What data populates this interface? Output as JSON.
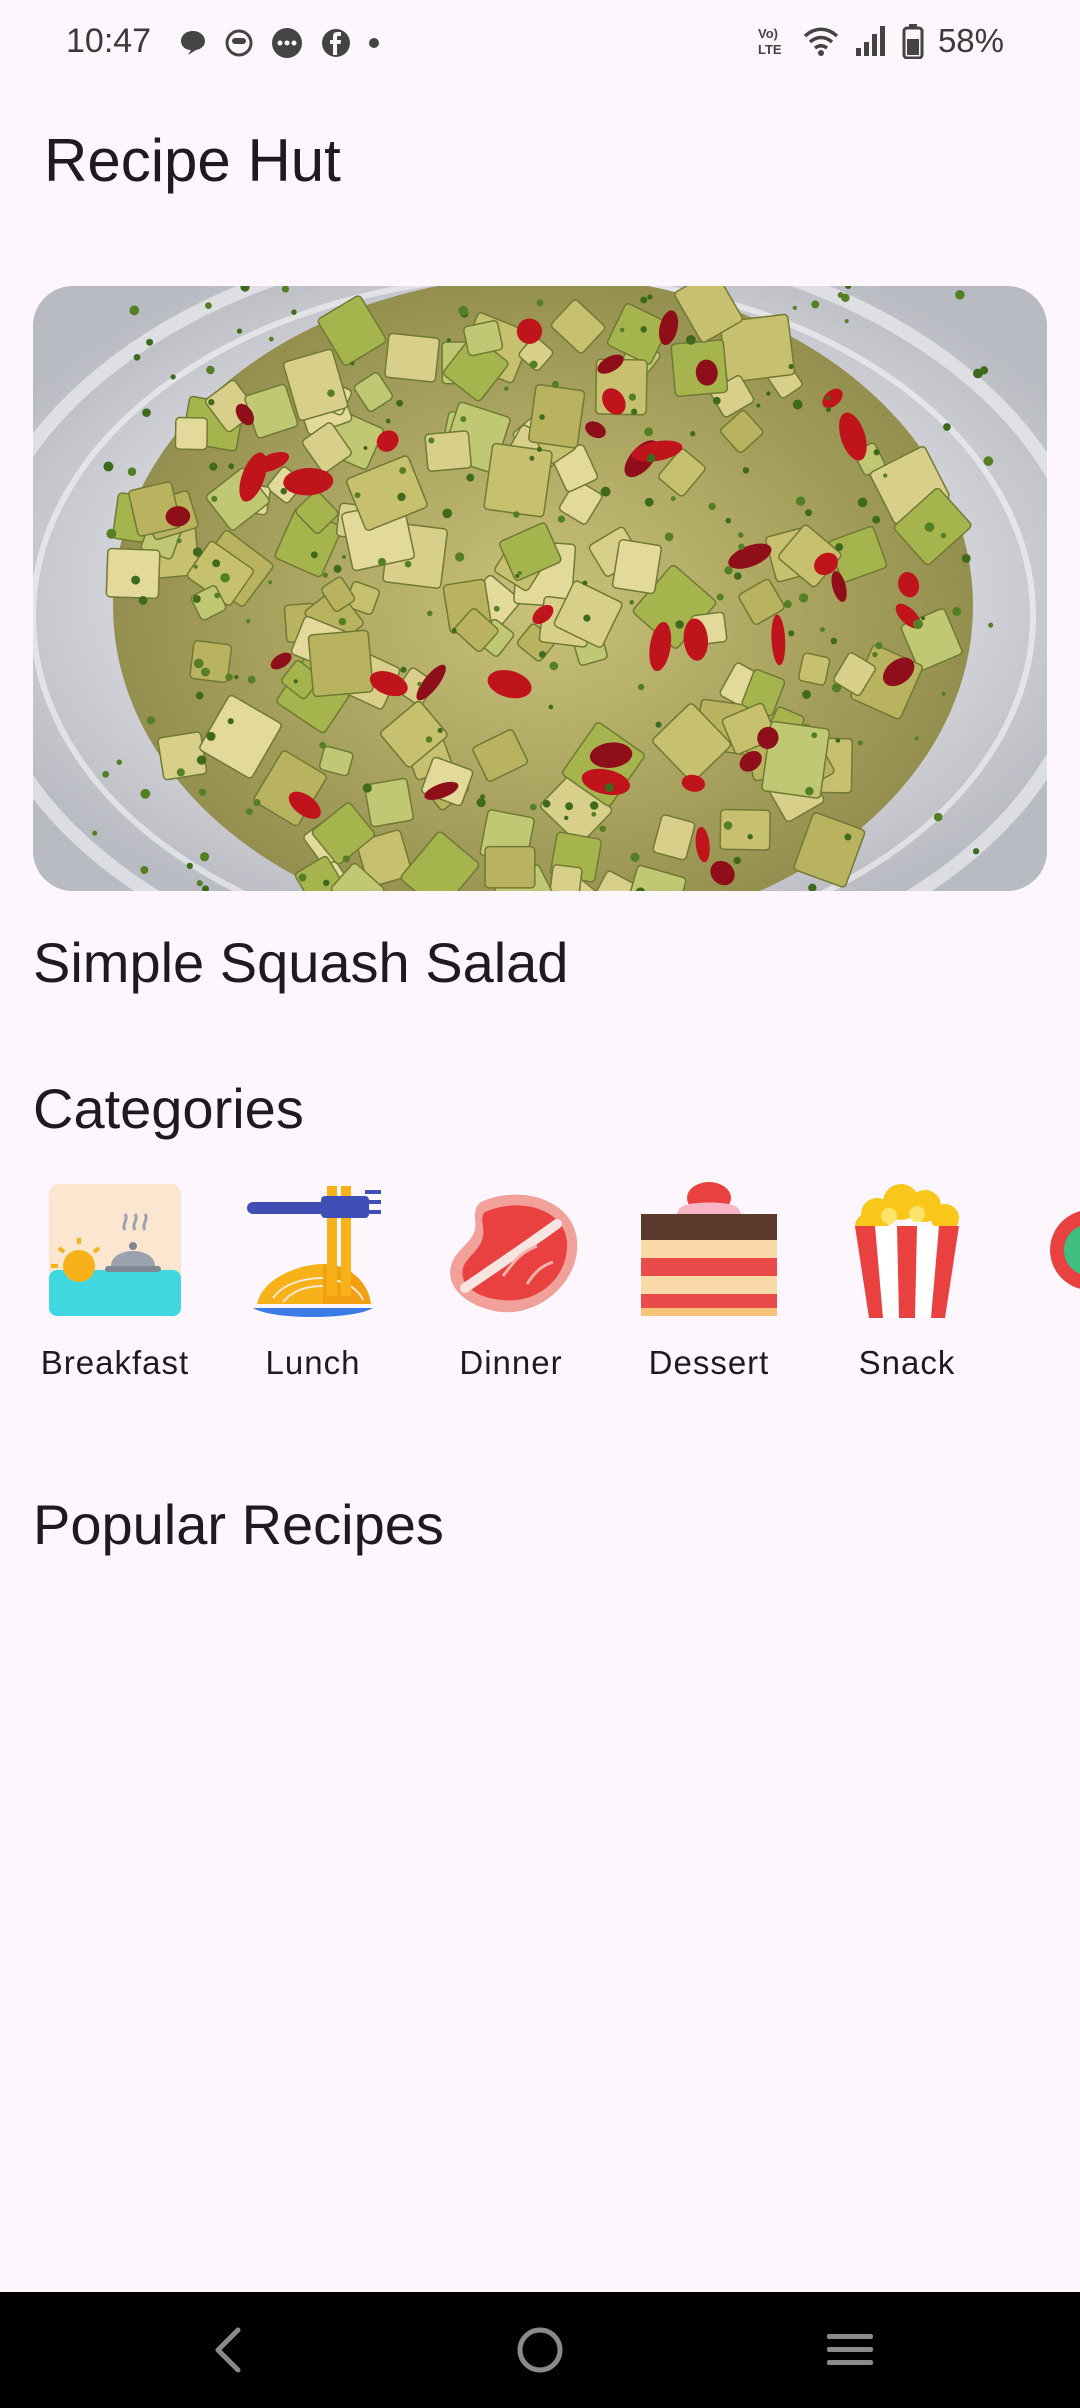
{
  "status_bar": {
    "time": "10:47",
    "battery_percent": "58%",
    "notification_icons": [
      "chat-bubble-icon",
      "messenger-face-icon",
      "messages-icon",
      "facebook-icon",
      "more-dot-icon"
    ],
    "system_icons": [
      "volte-icon",
      "wifi-icon",
      "signal-icon",
      "battery-icon"
    ]
  },
  "app": {
    "title": "Recipe Hut"
  },
  "featured": {
    "image_icon": "squash-salad-photo",
    "title": "Simple Squash Salad"
  },
  "categories": {
    "title": "Categories",
    "items": [
      {
        "label": "Breakfast",
        "icon": "breakfast-icon"
      },
      {
        "label": "Lunch",
        "icon": "noodles-icon"
      },
      {
        "label": "Dinner",
        "icon": "steak-icon"
      },
      {
        "label": "Dessert",
        "icon": "cake-icon"
      },
      {
        "label": "Snack",
        "icon": "popcorn-icon"
      }
    ]
  },
  "popular": {
    "title": "Popular Recipes"
  },
  "nav": {
    "icons": [
      "back-icon",
      "home-icon",
      "recents-icon"
    ]
  },
  "colors": {
    "background": "#fdf7fd",
    "text": "#1d1b20",
    "nav_bar": "#000000"
  }
}
